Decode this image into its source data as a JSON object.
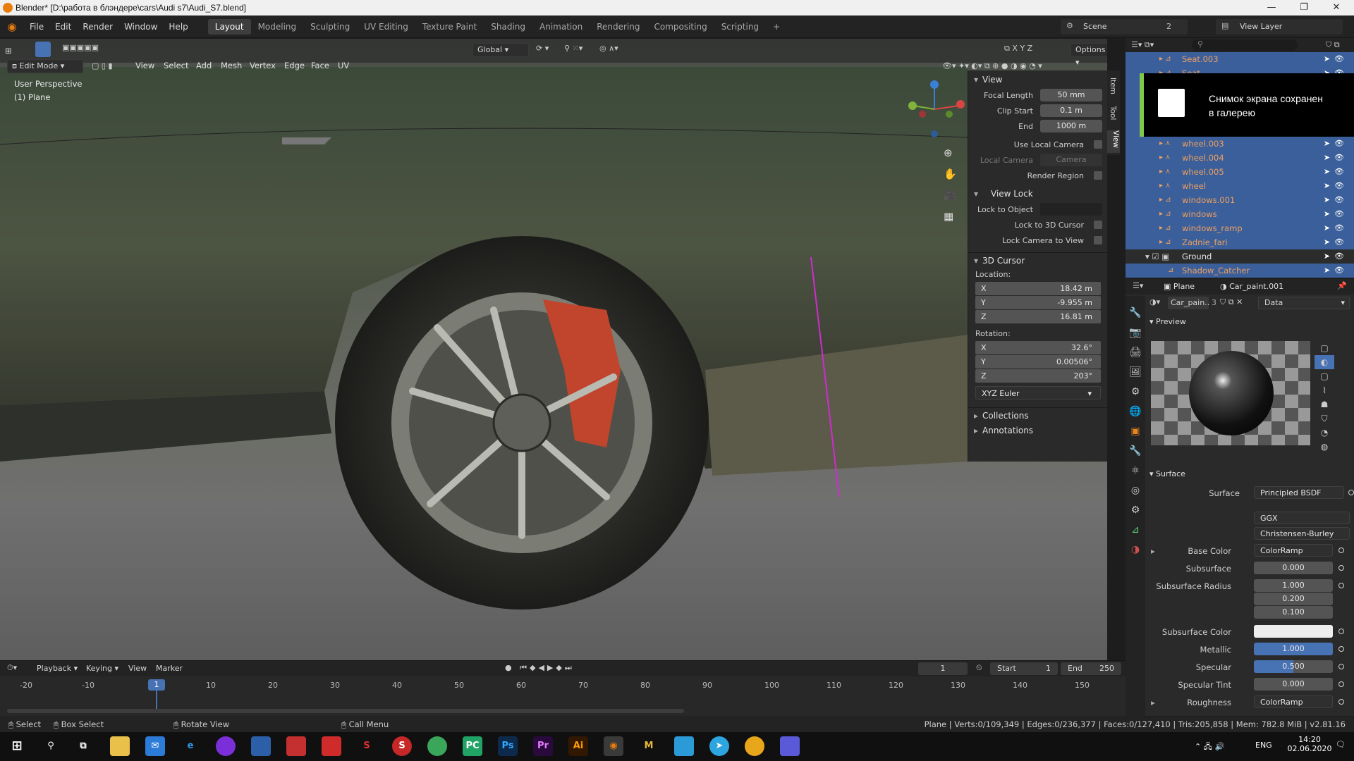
{
  "window": {
    "title": "Blender* [D:\\работа в блэндере\\cars\\Audi s7\\Audi_S7.blend]"
  },
  "menu": {
    "items": [
      "File",
      "Edit",
      "Render",
      "Window",
      "Help"
    ]
  },
  "workspaces": [
    "Layout",
    "Modeling",
    "Sculpting",
    "UV Editing",
    "Texture Paint",
    "Shading",
    "Animation",
    "Rendering",
    "Compositing",
    "Scripting"
  ],
  "topright": {
    "scene_label": "Scene",
    "scene_count": "2",
    "view_layer_label": "View Layer"
  },
  "viewport": {
    "mode": "Edit Mode",
    "menu": [
      "View",
      "Select",
      "Add",
      "Mesh",
      "Vertex",
      "Edge",
      "Face",
      "UV"
    ],
    "orientation": "Global",
    "options_label": "Options",
    "perspective": "User Perspective",
    "object_name": "(1) Plane"
  },
  "npanel": {
    "tabs": [
      "Item",
      "Tool",
      "View"
    ],
    "view_header": "View",
    "focal_length_label": "Focal Length",
    "focal_length": "50 mm",
    "clip_start_label": "Clip Start",
    "clip_start": "0.1 m",
    "end_label": "End",
    "end": "1000 m",
    "use_local_camera": "Use Local Camera",
    "local_camera": "Local Camera",
    "camera_placeholder": "Camera",
    "render_region": "Render Region",
    "view_lock_header": "View Lock",
    "lock_to_object": "Lock to Object",
    "lock_to_cursor": "Lock to 3D Cursor",
    "lock_camera_to_view": "Lock Camera to View",
    "cursor_header": "3D Cursor",
    "location_label": "Location:",
    "loc": [
      {
        "k": "X",
        "v": "18.42 m"
      },
      {
        "k": "Y",
        "v": "-9.955 m"
      },
      {
        "k": "Z",
        "v": "16.81 m"
      }
    ],
    "rotation_label": "Rotation:",
    "rot": [
      {
        "k": "X",
        "v": "32.6°"
      },
      {
        "k": "Y",
        "v": "0.00506°"
      },
      {
        "k": "Z",
        "v": "203°"
      }
    ],
    "rotation_mode": "XYZ Euler",
    "collections": "Collections",
    "annotations": "Annotations"
  },
  "outliner": {
    "rows": [
      {
        "name": "Seat.003"
      },
      {
        "name": "Seat"
      },
      {
        "name": "wheel.003"
      },
      {
        "name": "wheel.004"
      },
      {
        "name": "wheel.005"
      },
      {
        "name": "wheel"
      },
      {
        "name": "windows.001"
      },
      {
        "name": "windows"
      },
      {
        "name": "windows_ramp"
      },
      {
        "name": "Zadnie_fari"
      }
    ],
    "ground": "Ground",
    "shadow_catcher": "Shadow_Catcher"
  },
  "toast": {
    "line1": "Снимок экрана сохранен",
    "line2": "в галерею"
  },
  "properties": {
    "object": "Plane",
    "material": "Car_paint.001",
    "slot_name": "Car_pain..",
    "users": "3",
    "data_label": "Data",
    "preview_header": "Preview",
    "surface_header": "Surface",
    "surface_label": "Surface",
    "surface_value": "Principled BSDF",
    "distribution": "GGX",
    "subsurface_method": "Christensen-Burley",
    "rows": [
      {
        "label": "Base Color",
        "value": "ColorRamp"
      },
      {
        "label": "Subsurface",
        "value": "0.000"
      },
      {
        "label": "Subsurface Radius",
        "value": "1.000"
      },
      {
        "label": "",
        "value": "0.200"
      },
      {
        "label": "",
        "value": "0.100"
      },
      {
        "label": "Subsurface Color",
        "value": ""
      },
      {
        "label": "Metallic",
        "value": "1.000"
      },
      {
        "label": "Specular",
        "value": "0.500"
      },
      {
        "label": "Specular Tint",
        "value": "0.000"
      },
      {
        "label": "Roughness",
        "value": "ColorRamp"
      }
    ]
  },
  "timeline": {
    "menu": [
      "Playback",
      "Keying",
      "View",
      "Marker"
    ],
    "current_frame": "1",
    "start_label": "Start",
    "start": "1",
    "end_label": "End",
    "end": "250",
    "ticks": [
      "-20",
      "-10",
      "1",
      "10",
      "20",
      "30",
      "40",
      "50",
      "60",
      "70",
      "80",
      "90",
      "100",
      "110",
      "120",
      "130",
      "140",
      "150"
    ]
  },
  "status": {
    "select": "Select",
    "box_select": "Box Select",
    "rotate_view": "Rotate View",
    "call_menu": "Call Menu",
    "stats": "Plane | Verts:0/109,349 | Edges:0/236,377 | Faces:0/127,410 | Tris:205,858 | Mem: 782.8 MiB | v2.81.16"
  },
  "taskbar": {
    "lang": "ENG",
    "time": "14:20",
    "date": "02.06.2020"
  }
}
